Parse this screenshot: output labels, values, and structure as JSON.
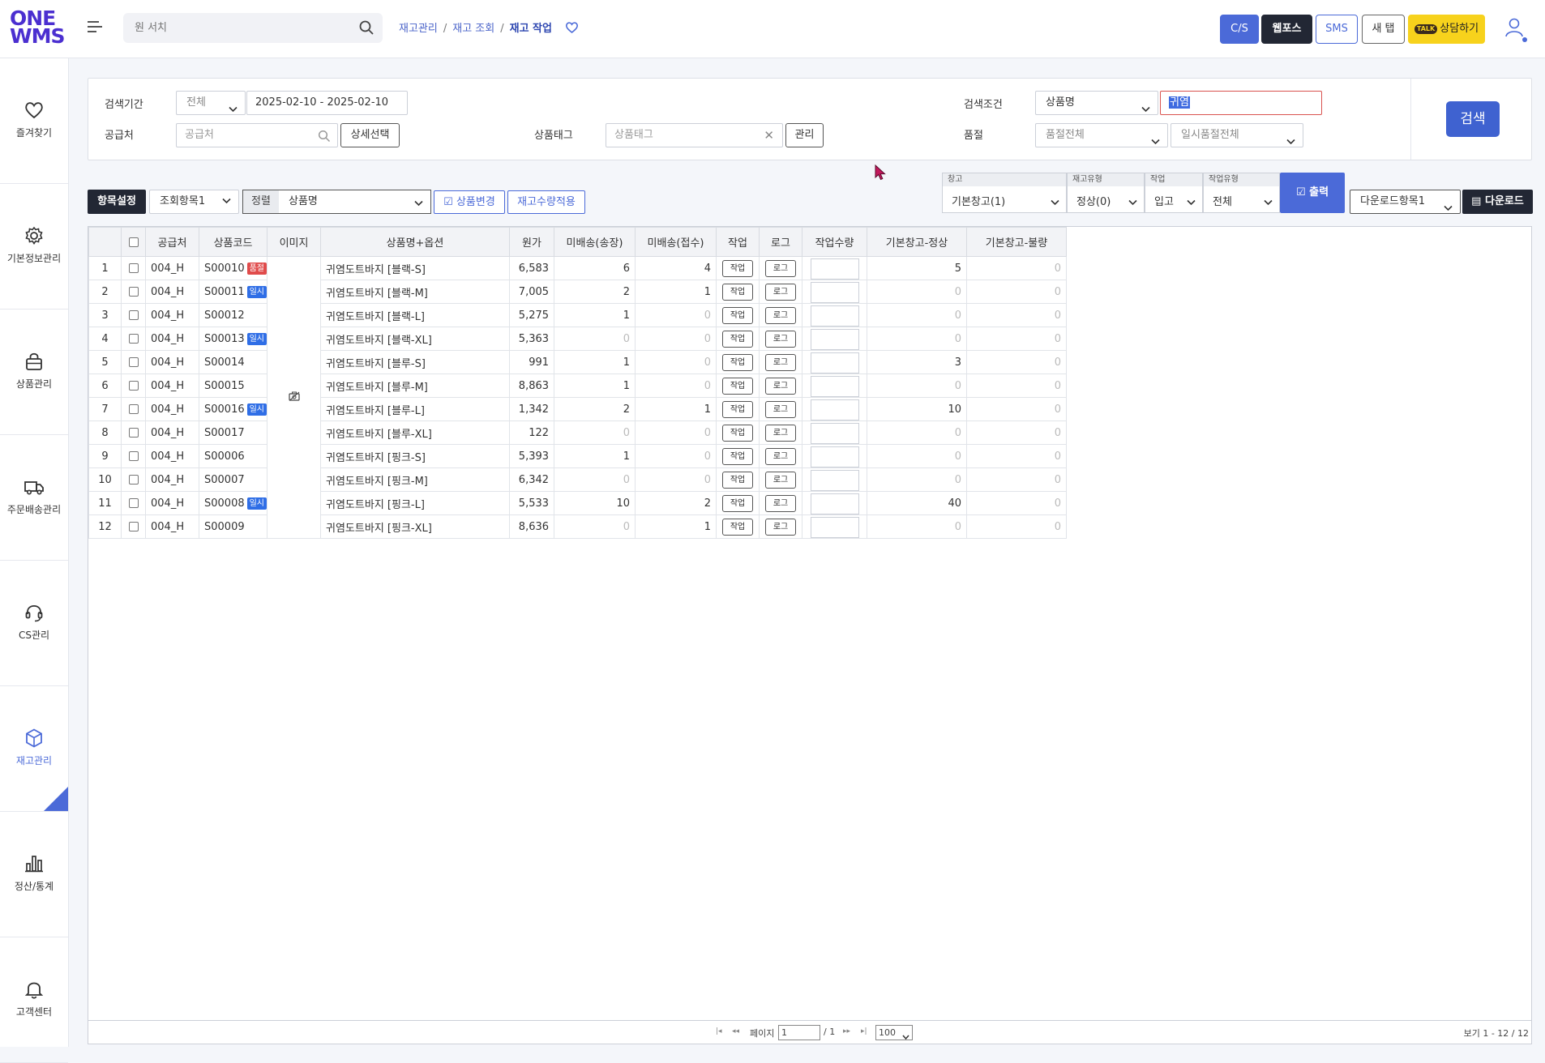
{
  "logo": {
    "line1": "ONE",
    "line2": "WMS"
  },
  "header": {
    "search_placeholder": "원 서치",
    "breadcrumb": [
      "재고관리",
      "재고 조회",
      "재고 작업"
    ],
    "buttons": {
      "cs": "C/S",
      "webforce": "웹포스",
      "sms": "SMS",
      "new_tab": "새 탭",
      "talk_badge": "TALK",
      "consult": "상담하기"
    }
  },
  "sidebar": [
    {
      "label": "즐겨찾기",
      "icon": "heart-icon"
    },
    {
      "label": "기본정보관리",
      "icon": "gear-icon"
    },
    {
      "label": "상품관리",
      "icon": "bag-icon"
    },
    {
      "label": "주문배송관리",
      "icon": "truck-icon"
    },
    {
      "label": "CS관리",
      "icon": "headset-icon"
    },
    {
      "label": "재고관리",
      "icon": "cube-icon",
      "active": true
    },
    {
      "label": "정산/통계",
      "icon": "bar-chart-icon"
    },
    {
      "label": "고객센터",
      "icon": "bell-icon"
    }
  ],
  "filters": {
    "period_label": "검색기간",
    "period_type": "전체",
    "period_range": "2025-02-10 - 2025-02-10",
    "supplier_label": "공급처",
    "supplier_placeholder": "공급처",
    "detail_select": "상세선택",
    "tag_label": "상품태그",
    "tag_placeholder": "상품태그",
    "tag_manage": "관리",
    "condition_label": "검색조건",
    "condition_field": "상품명",
    "condition_value": "귀염",
    "soldout_label": "품절",
    "soldout_value": "품절전체",
    "temp_soldout_value": "일시품절전체",
    "search_button": "검색"
  },
  "toolbar": {
    "column_settings": "항목설정",
    "query_set": "조회항목1",
    "sort_label": "정렬",
    "sort_value": "상품명",
    "product_change": "상품변경",
    "stock_apply": "재고수량적용",
    "warehouse_caption": "창고",
    "warehouse_value": "기본창고(1)",
    "stock_type_caption": "재고유형",
    "stock_type_value": "정상(0)",
    "work_caption": "작업",
    "work_value": "입고",
    "work_type_caption": "작업유형",
    "work_type_value": "전체",
    "print_button": "출력",
    "download_set": "다운로드항목1",
    "download_button": "다운로드"
  },
  "table": {
    "columns": [
      "",
      "",
      "공급처",
      "상품코드",
      "이미지",
      "상품명+옵션",
      "원가",
      "미배송(송장)",
      "미배송(접수)",
      "작업",
      "로그",
      "작업수량",
      "기본창고-정상",
      "기본창고-불량"
    ],
    "work_btn": "작업",
    "log_btn": "로그",
    "rows": [
      {
        "no": "1",
        "supplier": "004_H",
        "code": "S00010",
        "badge": "품절",
        "badge_color": "red",
        "name": "귀염도트바지 [블랙-S]",
        "cost": "6,583",
        "unsent_invoice": "6",
        "unsent_receipt": "4",
        "normal": "5",
        "defect": "0"
      },
      {
        "no": "2",
        "supplier": "004_H",
        "code": "S00011",
        "badge": "일시",
        "badge_color": "blue",
        "name": "귀염도트바지 [블랙-M]",
        "cost": "7,005",
        "unsent_invoice": "2",
        "unsent_receipt": "1",
        "normal": "0",
        "defect": "0"
      },
      {
        "no": "3",
        "supplier": "004_H",
        "code": "S00012",
        "badge": "",
        "badge_color": "",
        "name": "귀염도트바지 [블랙-L]",
        "cost": "5,275",
        "unsent_invoice": "1",
        "unsent_receipt": "0",
        "normal": "0",
        "defect": "0"
      },
      {
        "no": "4",
        "supplier": "004_H",
        "code": "S00013",
        "badge": "일시",
        "badge_color": "blue",
        "name": "귀염도트바지 [블랙-XL]",
        "cost": "5,363",
        "unsent_invoice": "0",
        "unsent_receipt": "0",
        "normal": "0",
        "defect": "0"
      },
      {
        "no": "5",
        "supplier": "004_H",
        "code": "S00014",
        "badge": "",
        "badge_color": "",
        "name": "귀염도트바지 [블루-S]",
        "cost": "991",
        "unsent_invoice": "1",
        "unsent_receipt": "0",
        "normal": "3",
        "defect": "0"
      },
      {
        "no": "6",
        "supplier": "004_H",
        "code": "S00015",
        "badge": "",
        "badge_color": "",
        "name": "귀염도트바지 [블루-M]",
        "cost": "8,863",
        "unsent_invoice": "1",
        "unsent_receipt": "0",
        "normal": "0",
        "defect": "0"
      },
      {
        "no": "7",
        "supplier": "004_H",
        "code": "S00016",
        "badge": "일시",
        "badge_color": "blue",
        "name": "귀염도트바지 [블루-L]",
        "cost": "1,342",
        "unsent_invoice": "2",
        "unsent_receipt": "1",
        "normal": "10",
        "defect": "0"
      },
      {
        "no": "8",
        "supplier": "004_H",
        "code": "S00017",
        "badge": "",
        "badge_color": "",
        "name": "귀염도트바지 [블루-XL]",
        "cost": "122",
        "unsent_invoice": "0",
        "unsent_receipt": "0",
        "normal": "0",
        "defect": "0"
      },
      {
        "no": "9",
        "supplier": "004_H",
        "code": "S00006",
        "badge": "",
        "badge_color": "",
        "name": "귀염도트바지 [핑크-S]",
        "cost": "5,393",
        "unsent_invoice": "1",
        "unsent_receipt": "0",
        "normal": "0",
        "defect": "0"
      },
      {
        "no": "10",
        "supplier": "004_H",
        "code": "S00007",
        "badge": "",
        "badge_color": "",
        "name": "귀염도트바지 [핑크-M]",
        "cost": "6,342",
        "unsent_invoice": "0",
        "unsent_receipt": "0",
        "normal": "0",
        "defect": "0"
      },
      {
        "no": "11",
        "supplier": "004_H",
        "code": "S00008",
        "badge": "일시",
        "badge_color": "blue",
        "name": "귀염도트바지 [핑크-L]",
        "cost": "5,533",
        "unsent_invoice": "10",
        "unsent_receipt": "2",
        "normal": "40",
        "defect": "0"
      },
      {
        "no": "12",
        "supplier": "004_H",
        "code": "S00009",
        "badge": "",
        "badge_color": "",
        "name": "귀염도트바지 [핑크-XL]",
        "cost": "8,636",
        "unsent_invoice": "0",
        "unsent_receipt": "1",
        "normal": "0",
        "defect": "0"
      }
    ]
  },
  "pager": {
    "page_label": "페이지",
    "page_value": "1",
    "total_pages": "/ 1",
    "page_size": "100",
    "summary": "보기 1 - 12 / 12"
  },
  "colors": {
    "accent": "#4b6ad8",
    "dark": "#222734",
    "logo": "#4b2fd0",
    "kakao": "#f7d21c"
  }
}
